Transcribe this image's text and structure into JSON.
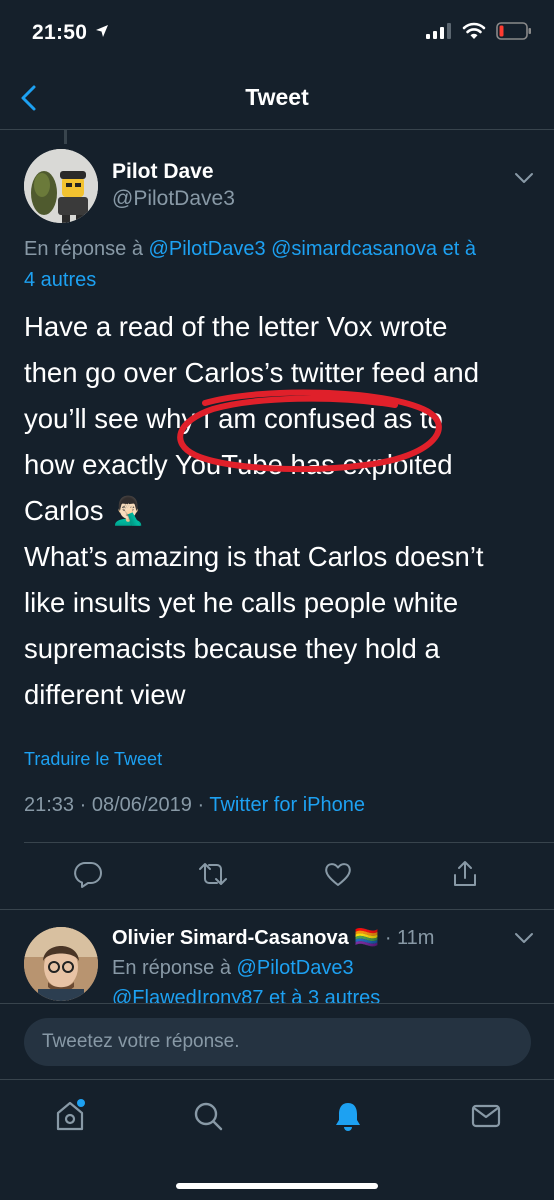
{
  "status": {
    "time": "21:50"
  },
  "nav": {
    "title": "Tweet"
  },
  "tweet": {
    "author_name": "Pilot Dave",
    "author_handle": "@PilotDave3",
    "reply_prefix": "En réponse à",
    "reply_mentions": "@PilotDave3 @simardcasanova",
    "reply_and": "et à",
    "reply_others": "4 autres",
    "text_lines": [
      "Have a read of the letter Vox wrote",
      "then go over Carlos’s twitter feed and",
      "you’ll see why I am confused as to",
      "how exactly YouTube has exploited",
      "Carlos 🤦🏻‍♂️",
      "What’s amazing is that Carlos doesn’t",
      "like insults yet he calls people white",
      "supremacists because they hold a",
      "different view"
    ],
    "translate_label": "Traduire le Tweet",
    "timestamp": "21:33 · 08/06/2019 ·",
    "source": "Twitter for iPhone"
  },
  "reply": {
    "author_name": "Olivier Simard-Casanova",
    "flag": "🏳️‍🌈",
    "time": "· 11m",
    "reply_prefix": "En réponse à",
    "mention_1": "@PilotDave3",
    "mention_2": "@FlawedIrony87",
    "reply_and": "et à",
    "reply_others": "3 autres"
  },
  "compose": {
    "placeholder": "Tweetez votre réponse."
  },
  "colors": {
    "background": "#15202b",
    "accent": "#1da1f2",
    "muted": "#8899a6",
    "border": "#38444d",
    "annotation": "#e0202a"
  },
  "icons": [
    "back-chevron-icon",
    "chevron-down-icon",
    "reply-icon",
    "retweet-icon",
    "like-icon",
    "share-icon",
    "home-icon",
    "search-icon",
    "notifications-icon",
    "messages-icon",
    "signal-icon",
    "wifi-icon",
    "battery-icon",
    "location-arrow-icon"
  ]
}
